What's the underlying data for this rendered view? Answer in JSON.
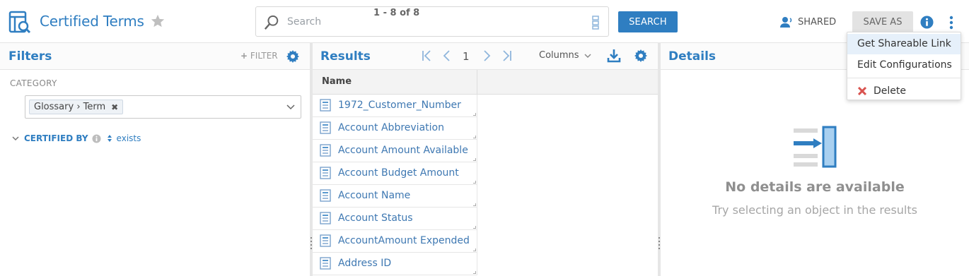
{
  "app": {
    "title": "Certified Terms"
  },
  "search": {
    "placeholder": "Search",
    "button_label": "SEARCH"
  },
  "header": {
    "shared_label": "SHARED",
    "save_as_label": "SAVE AS"
  },
  "menu": {
    "items": [
      "Get Shareable Link",
      "Edit Configurations",
      "Delete"
    ]
  },
  "filters": {
    "title": "Filters",
    "add_label": "FILTER",
    "category_label": "CATEGORY",
    "category_chip": "Glossary › Term",
    "certified_by_label": "CERTIFIED BY",
    "exists_label": "exists"
  },
  "results": {
    "title": "Results",
    "range": "1 - 8 of 8",
    "page": "1",
    "columns_label": "Columns",
    "column_header": "Name",
    "rows": [
      "1972_Customer_Number",
      "Account Abbreviation",
      "Account Amount Available",
      "Account Budget Amount",
      "Account Name",
      "Account Status",
      "AccountAmount Expended",
      "Address ID"
    ]
  },
  "details": {
    "title": "Details",
    "empty_title": "No details are available",
    "empty_subtitle": "Try selecting an object in the results"
  },
  "colors": {
    "accent": "#2f7ec1",
    "menu_highlight": "#e6f0fa",
    "delete_red": "#d9534f"
  },
  "icons": [
    "app-icon",
    "star-icon",
    "search-icon",
    "qualifier-icon",
    "shared-user-icon",
    "info-icon",
    "kebab-icon",
    "plus-icon",
    "gear-icon",
    "chevron-down-icon",
    "info-small-icon",
    "sort-icon",
    "first-page-icon",
    "prev-page-icon",
    "next-page-icon",
    "last-page-icon",
    "download-icon",
    "document-icon",
    "details-empty-icon",
    "delete-x-icon"
  ]
}
